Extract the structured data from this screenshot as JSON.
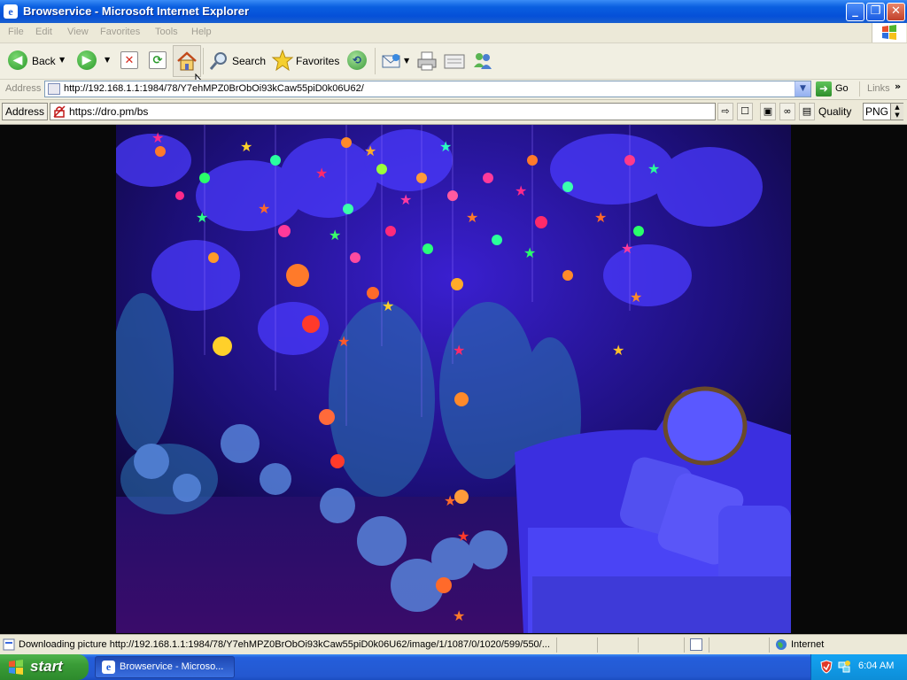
{
  "window": {
    "title": "Browservice - Microsoft Internet Explorer"
  },
  "menu": [
    "File",
    "Edit",
    "View",
    "Favorites",
    "Tools",
    "Help"
  ],
  "toolbar": {
    "back_label": "Back",
    "search_label": "Search",
    "favorites_label": "Favorites"
  },
  "address_bar": {
    "label": "Address",
    "url": "http://192.168.1.1:1984/78/Y7ehMPZ0BrObOi93kCaw55piD0k06U62/",
    "go_label": "Go",
    "links_label": "Links"
  },
  "inner_bar": {
    "address_label": "Address",
    "url": "https://dro.pm/bs",
    "quality_label": "Quality",
    "quality_value": "PNG"
  },
  "status_bar": {
    "text": "Downloading picture http://192.168.1.1:1984/78/Y7ehMPZ0BrObOi93kCaw55piD0k06U62/image/1/1087/0/1020/599/550/...",
    "zone": "Internet"
  },
  "taskbar": {
    "start_label": "start",
    "task_label": "Browservice - Microso...",
    "clock": "6:04 AM"
  },
  "colors": {
    "title_blue": "#0550d8",
    "taskbar_blue": "#245edb",
    "start_green": "#3a9c37",
    "tray_blue": "#0d8ed8",
    "photo_base": "#120a45"
  }
}
